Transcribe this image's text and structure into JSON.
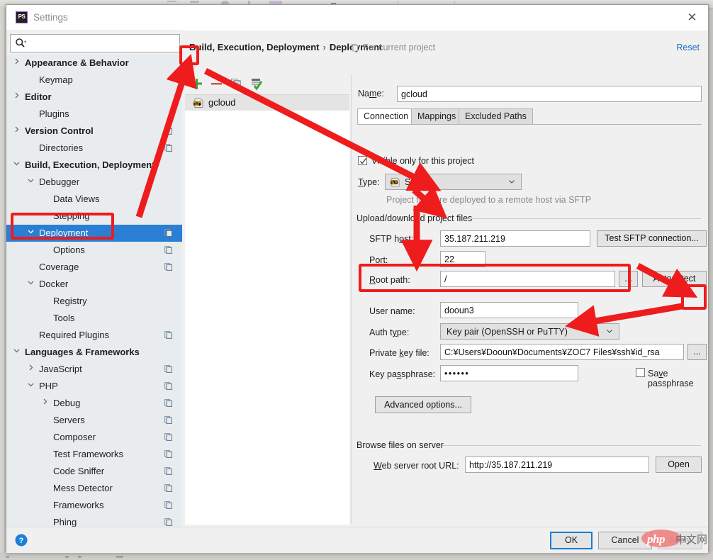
{
  "window": {
    "title": "Settings",
    "app_icon": "phpstorm-icon",
    "close_label": "✕"
  },
  "search": {
    "value": "",
    "placeholder": ""
  },
  "sidebar": {
    "items": [
      {
        "label": "Appearance & Behavior",
        "indent": 0,
        "twisty": "collapsed",
        "copy": false,
        "selected": false
      },
      {
        "label": "Keymap",
        "indent": 1,
        "twisty": "none",
        "copy": false,
        "selected": false
      },
      {
        "label": "Editor",
        "indent": 0,
        "twisty": "collapsed",
        "copy": false,
        "selected": false
      },
      {
        "label": "Plugins",
        "indent": 1,
        "twisty": "none",
        "copy": false,
        "selected": false
      },
      {
        "label": "Version Control",
        "indent": 0,
        "twisty": "collapsed",
        "copy": true,
        "selected": false
      },
      {
        "label": "Directories",
        "indent": 1,
        "twisty": "none",
        "copy": true,
        "selected": false
      },
      {
        "label": "Build, Execution, Deployment",
        "indent": 0,
        "twisty": "expanded",
        "copy": false,
        "selected": false
      },
      {
        "label": "Debugger",
        "indent": 1,
        "twisty": "expanded",
        "copy": false,
        "selected": false
      },
      {
        "label": "Data Views",
        "indent": 2,
        "twisty": "none",
        "copy": false,
        "selected": false
      },
      {
        "label": "Stepping",
        "indent": 2,
        "twisty": "none",
        "copy": false,
        "selected": false
      },
      {
        "label": "Deployment",
        "indent": 1,
        "twisty": "expanded",
        "copy": true,
        "selected": true
      },
      {
        "label": "Options",
        "indent": 2,
        "twisty": "none",
        "copy": true,
        "selected": false
      },
      {
        "label": "Coverage",
        "indent": 1,
        "twisty": "none",
        "copy": true,
        "selected": false
      },
      {
        "label": "Docker",
        "indent": 1,
        "twisty": "expanded",
        "copy": false,
        "selected": false
      },
      {
        "label": "Registry",
        "indent": 2,
        "twisty": "none",
        "copy": false,
        "selected": false
      },
      {
        "label": "Tools",
        "indent": 2,
        "twisty": "none",
        "copy": false,
        "selected": false
      },
      {
        "label": "Required Plugins",
        "indent": 1,
        "twisty": "none",
        "copy": true,
        "selected": false
      },
      {
        "label": "Languages & Frameworks",
        "indent": 0,
        "twisty": "expanded",
        "copy": false,
        "selected": false
      },
      {
        "label": "JavaScript",
        "indent": 1,
        "twisty": "collapsed",
        "copy": true,
        "selected": false
      },
      {
        "label": "PHP",
        "indent": 1,
        "twisty": "expanded",
        "copy": true,
        "selected": false
      },
      {
        "label": "Debug",
        "indent": 2,
        "twisty": "collapsed",
        "copy": true,
        "selected": false
      },
      {
        "label": "Servers",
        "indent": 2,
        "twisty": "none",
        "copy": true,
        "selected": false
      },
      {
        "label": "Composer",
        "indent": 2,
        "twisty": "none",
        "copy": true,
        "selected": false
      },
      {
        "label": "Test Frameworks",
        "indent": 2,
        "twisty": "none",
        "copy": true,
        "selected": false
      },
      {
        "label": "Code Sniffer",
        "indent": 2,
        "twisty": "none",
        "copy": true,
        "selected": false
      },
      {
        "label": "Mess Detector",
        "indent": 2,
        "twisty": "none",
        "copy": true,
        "selected": false
      },
      {
        "label": "Frameworks",
        "indent": 2,
        "twisty": "none",
        "copy": true,
        "selected": false
      },
      {
        "label": "Phing",
        "indent": 2,
        "twisty": "none",
        "copy": true,
        "selected": false
      }
    ]
  },
  "header": {
    "breadcrumb_root": "Build, Execution, Deployment",
    "breadcrumb_sep": "›",
    "breadcrumb_leaf": "Deployment",
    "for_current_project": "For current project",
    "reset_label": "Reset"
  },
  "list_toolbar": {
    "add_label": "+",
    "remove_label": "−",
    "copy_label": "copy-icon",
    "validate_label": "validate-icon"
  },
  "server_list": {
    "items": [
      {
        "label": "gcloud",
        "icon": "sftp",
        "selected": true
      }
    ]
  },
  "form": {
    "name_label": "Name:",
    "name_value": "gcloud",
    "tabs": [
      {
        "label": "Connection",
        "active": true
      },
      {
        "label": "Mappings",
        "active": false
      },
      {
        "label": "Excluded Paths",
        "active": false
      }
    ],
    "visible_only_label": "Visible only for this project",
    "visible_only_checked": true,
    "type_label": "Type:",
    "type_value": "SFTP",
    "type_hint": "Project files are deployed to a remote host via SFTP",
    "upload_group_label": "Upload/download project files",
    "sftp_host_label": "SFTP host:",
    "sftp_host_value": "35.187.211.219",
    "test_connection_label": "Test SFTP connection...",
    "port_label": "Port:",
    "port_value": "22",
    "root_path_label": "Root path:",
    "root_path_value": "/",
    "browse_label": "...",
    "autodetect_label": "Autodetect",
    "user_name_label": "User name:",
    "user_name_value": "dooun3",
    "auth_type_label": "Auth type:",
    "auth_type_value": "Key pair (OpenSSH or PuTTY)",
    "private_key_label": "Private key file:",
    "private_key_value": "C:¥Users¥Dooun¥Documents¥ZOC7 Files¥ssh¥id_rsa",
    "private_key_browse_label": "...",
    "key_passphrase_label": "Key passphrase:",
    "key_passphrase_value": "••••••",
    "save_passphrase_label": "Save passphrase",
    "save_passphrase_checked": false,
    "advanced_options_label": "Advanced options...",
    "browse_group_label": "Browse files on server",
    "web_root_label": "Web server root URL:",
    "web_root_value": "http://35.187.211.219",
    "open_label": "Open"
  },
  "footer": {
    "help_label": "?",
    "ok_label": "OK",
    "cancel_label": "Cancel",
    "apply_label": "Apply"
  },
  "watermark": {
    "php": "php",
    "cn": "中文网"
  },
  "colors": {
    "selection_blue": "#2a7fd4",
    "annotation_red": "#ee1c1c",
    "link_blue": "#1a6fc4"
  }
}
